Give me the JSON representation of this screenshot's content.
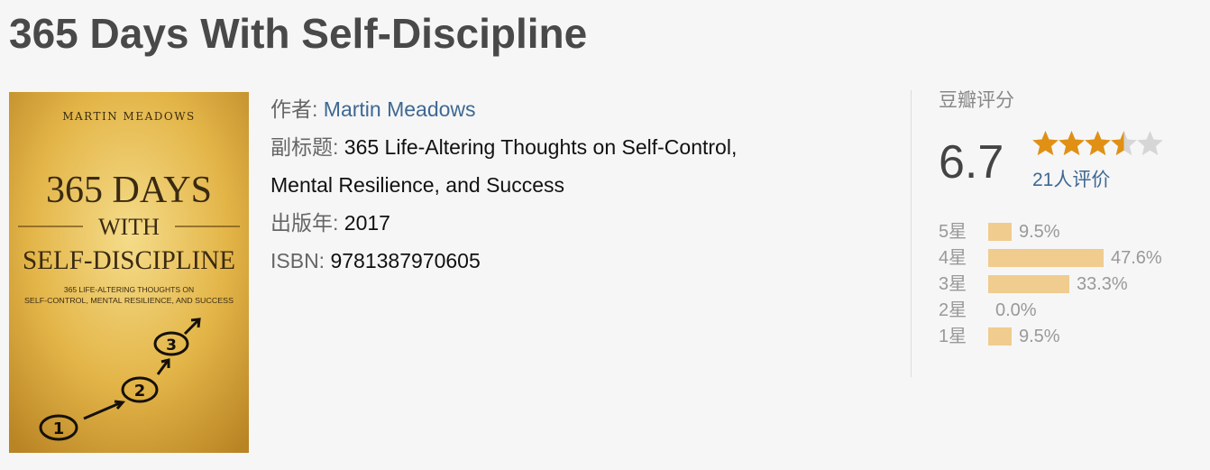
{
  "page": {
    "title": "365 Days With Self-Discipline"
  },
  "cover": {
    "author": "MARTIN MEADOWS",
    "line1": "365 DAYS",
    "line2": "WITH",
    "line3": "SELF-DISCIPLINE",
    "tagline1": "365 LIFE-ALTERING THOUGHTS ON",
    "tagline2": "SELF-CONTROL, MENTAL RESILIENCE, AND SUCCESS",
    "step1": "1",
    "step2": "2",
    "step3": "3"
  },
  "info": {
    "author_label": "作者:",
    "author": "Martin Meadows",
    "subtitle_label": "副标题:",
    "subtitle_line1": "365 Life-Altering Thoughts on Self-Control,",
    "subtitle_line2": "Mental Resilience, and Success",
    "year_label": "出版年:",
    "year": "2017",
    "isbn_label": "ISBN:",
    "isbn": "9781387970605"
  },
  "rating": {
    "title": "豆瓣评分",
    "score": "6.7",
    "stars_value": 3.5,
    "stars_max": 5,
    "votes": "21人评价",
    "star_color": "#e09015",
    "bar_color": "#f0cc8f",
    "distribution": [
      {
        "label": "5星",
        "percent": 9.5,
        "percent_text": "9.5%"
      },
      {
        "label": "4星",
        "percent": 47.6,
        "percent_text": "47.6%"
      },
      {
        "label": "3星",
        "percent": 33.3,
        "percent_text": "33.3%"
      },
      {
        "label": "2星",
        "percent": 0.0,
        "percent_text": "0.0%"
      },
      {
        "label": "1星",
        "percent": 9.5,
        "percent_text": "9.5%"
      }
    ]
  }
}
